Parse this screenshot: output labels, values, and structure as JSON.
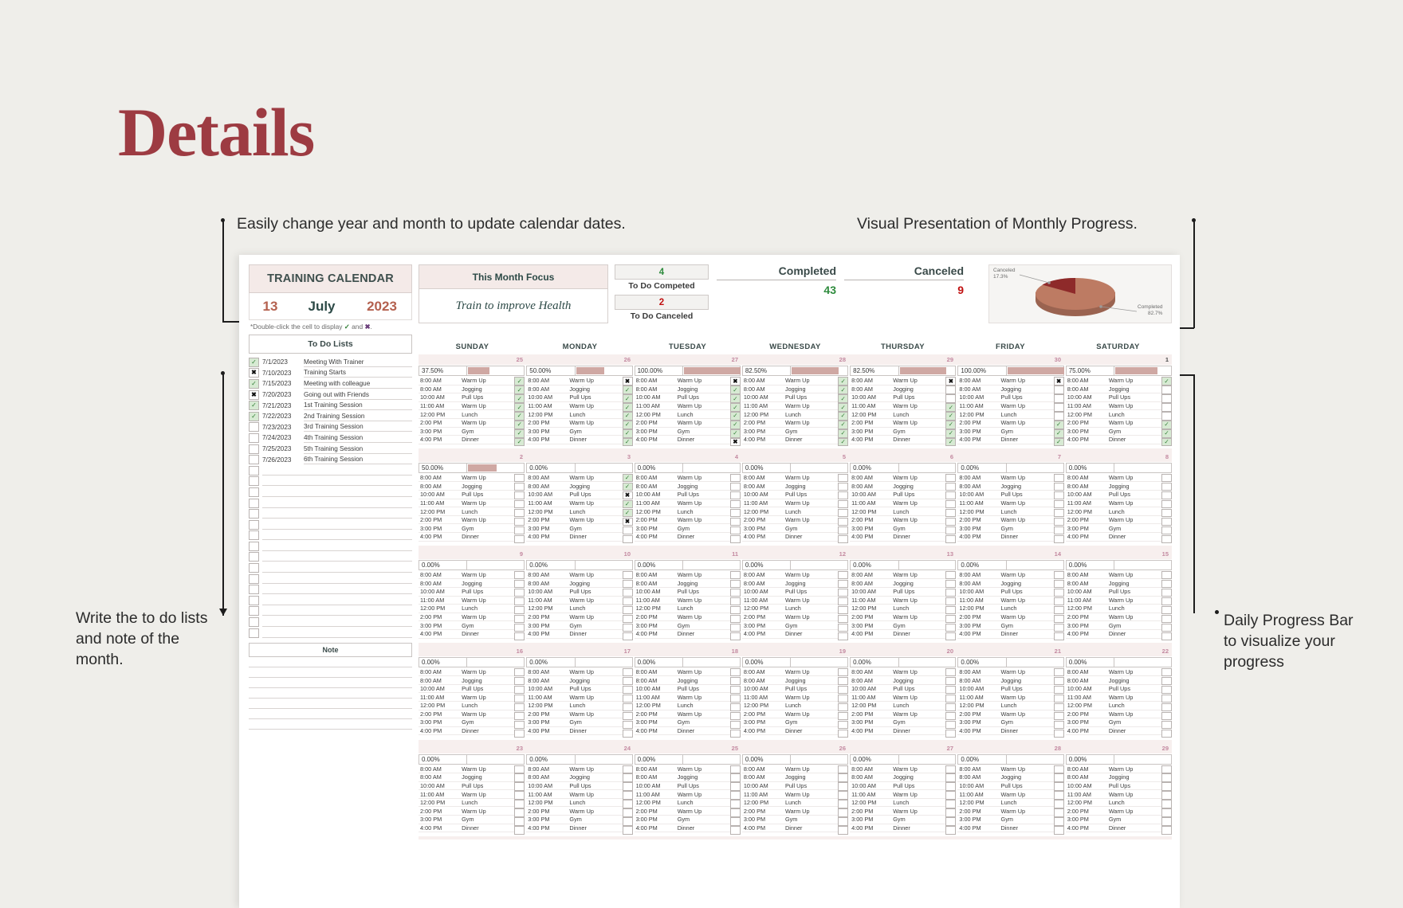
{
  "page": {
    "title": "Details"
  },
  "annotations": {
    "top_left": "Easily change year and month to update calendar dates.",
    "top_right": "Visual Presentation of Monthly Progress.",
    "bottom_left": "Write the to do lists and note of the month.",
    "bottom_right": "Daily Progress Bar to visualize your progress"
  },
  "sheet": {
    "calendar_title": "TRAINING CALENDAR",
    "date": {
      "day": "13",
      "month": "July",
      "year": "2023"
    },
    "hint_prefix": "*Double-click the cell to display ",
    "hint_check": "✓",
    "hint_and": " and ",
    "hint_cross": "✖",
    "hint_suffix": ".",
    "focus": {
      "label": "This Month Focus",
      "value": "Train to improve Health"
    },
    "stats": {
      "todo_completed_value": "4",
      "todo_completed_label": "To Do Competed",
      "todo_canceled_value": "2",
      "todo_canceled_label": "To Do Canceled",
      "completed_label": "Completed",
      "completed_value": "43",
      "canceled_label": "Canceled",
      "canceled_value": "9"
    },
    "todo": {
      "header": "To Do Lists",
      "note_label": "Note",
      "items": [
        {
          "state": "done",
          "date": "7/1/2023",
          "text": "Meeting With Trainer"
        },
        {
          "state": "canceled",
          "date": "7/10/2023",
          "text": "Training Starts"
        },
        {
          "state": "done",
          "date": "7/15/2023",
          "text": "Meeting with colleague"
        },
        {
          "state": "canceled",
          "date": "7/20/2023",
          "text": "Going out with Friends"
        },
        {
          "state": "done",
          "date": "7/21/2023",
          "text": "1st Training Session"
        },
        {
          "state": "done",
          "date": "7/22/2023",
          "text": "2nd Training Session"
        },
        {
          "state": "empty",
          "date": "7/23/2023",
          "text": "3rd Training Session"
        },
        {
          "state": "empty",
          "date": "7/24/2023",
          "text": "4th Training Session"
        },
        {
          "state": "empty",
          "date": "7/25/2023",
          "text": "5th Training Session"
        },
        {
          "state": "empty",
          "date": "7/26/2023",
          "text": "6th Training Session"
        }
      ]
    },
    "weekdays": [
      "SUNDAY",
      "MONDAY",
      "TUESDAY",
      "WEDNESDAY",
      "THURSDAY",
      "FRIDAY",
      "SATURDAY"
    ],
    "day_template": [
      {
        "time": "8:00 AM",
        "activity": "Warm Up"
      },
      {
        "time": "8:00 AM",
        "activity": "Jogging"
      },
      {
        "time": "10:00 AM",
        "activity": "Pull Ups"
      },
      {
        "time": "11:00 AM",
        "activity": "Warm Up"
      },
      {
        "time": "12:00 PM",
        "activity": "Lunch"
      },
      {
        "time": "2:00 PM",
        "activity": "Warm Up"
      },
      {
        "time": "3:00 PM",
        "activity": "Gym"
      },
      {
        "time": "4:00 PM",
        "activity": "Dinner"
      }
    ],
    "weeks": [
      {
        "numbers": [
          "",
          "25",
          "26",
          "27",
          "28",
          "29",
          "30",
          "1"
        ],
        "percents": [
          "37.50%",
          "50.00%",
          "100.00%",
          "82.50%",
          "82.50%",
          "100.00%",
          "75.00%"
        ],
        "checks": [
          [
            "y",
            "n",
            "n",
            "y",
            "n",
            "n",
            "y",
            "n"
          ],
          [
            "y",
            "y",
            "y",
            "y",
            "",
            "",
            "",
            ""
          ],
          [
            "y",
            "y",
            "y",
            "y",
            "",
            "",
            "",
            ""
          ],
          [
            "y",
            "y",
            "y",
            "y",
            "y",
            "",
            "",
            ""
          ],
          [
            "y",
            "y",
            "y",
            "y",
            "y",
            "",
            "",
            ""
          ],
          [
            "y",
            "y",
            "y",
            "y",
            "y",
            "y",
            "y",
            ""
          ],
          [
            "y",
            "y",
            "y",
            "y",
            "y",
            "y",
            "y",
            "y"
          ],
          [
            "y",
            "y",
            "n",
            "y",
            "y",
            "y",
            "y",
            "n"
          ]
        ]
      },
      {
        "numbers": [
          "2",
          "3",
          "4",
          "5",
          "6",
          "7",
          "8"
        ],
        "percents": [
          "50.00%",
          "0.00%",
          "0.00%",
          "0.00%",
          "0.00%",
          "0.00%",
          "0.00%"
        ],
        "checks": [
          [
            "",
            "y",
            "",
            "",
            "",
            "",
            "",
            ""
          ],
          [
            "",
            "y",
            "",
            "",
            "",
            "",
            "",
            ""
          ],
          [
            "",
            "n",
            "",
            "",
            "",
            "",
            "",
            ""
          ],
          [
            "",
            "y",
            "",
            "",
            "",
            "",
            "",
            ""
          ],
          [
            "",
            "y",
            "",
            "",
            "",
            "",
            "",
            ""
          ],
          [
            "",
            "n",
            "",
            "",
            "",
            "",
            "",
            ""
          ],
          [
            "",
            "",
            "",
            "",
            "",
            "",
            "",
            ""
          ],
          [
            "",
            "",
            "",
            "",
            "",
            "",
            "",
            ""
          ]
        ]
      },
      {
        "numbers": [
          "9",
          "10",
          "11",
          "12",
          "13",
          "14",
          "15"
        ],
        "percents": [
          "0.00%",
          "0.00%",
          "0.00%",
          "0.00%",
          "0.00%",
          "0.00%",
          "0.00%"
        ],
        "checks": [
          [],
          [],
          [],
          [],
          [],
          [],
          [],
          []
        ]
      },
      {
        "numbers": [
          "16",
          "17",
          "18",
          "19",
          "20",
          "21",
          "22"
        ],
        "percents": [
          "0.00%",
          "0.00%",
          "0.00%",
          "0.00%",
          "0.00%",
          "0.00%",
          "0.00%"
        ],
        "checks": [
          [],
          [],
          [],
          [],
          [],
          [],
          [],
          []
        ]
      },
      {
        "numbers": [
          "23",
          "24",
          "25",
          "26",
          "27",
          "28",
          "29"
        ],
        "percents": [
          "0.00%",
          "0.00%",
          "0.00%",
          "0.00%",
          "0.00%",
          "0.00%",
          "0.00%"
        ],
        "checks": [
          [],
          [],
          [],
          [],
          [],
          [],
          [],
          []
        ]
      }
    ]
  },
  "chart_data": {
    "type": "pie",
    "title": "",
    "labels": [
      "Canceled",
      "Completed"
    ],
    "values": [
      17.3,
      82.7
    ],
    "value_labels": [
      "17.3%",
      "82.7%"
    ],
    "colors": [
      "#8e2a2a",
      "#bd7b63"
    ],
    "legend": "callout-labels"
  }
}
